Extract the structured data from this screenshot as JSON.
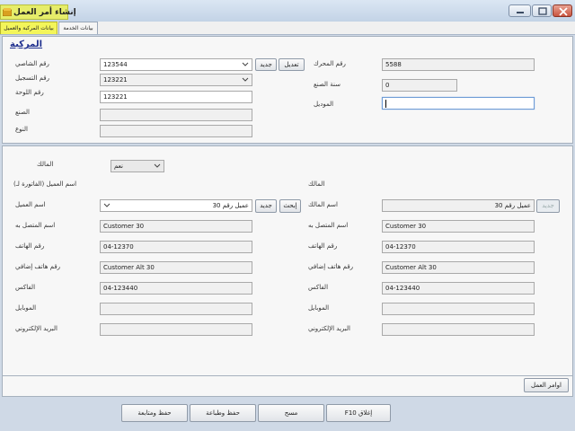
{
  "window": {
    "title": "إنشاء أمر العمل"
  },
  "tabs": [
    {
      "label": "بيانات المركبة والعميل"
    },
    {
      "label": "بيانات الخدمة"
    }
  ],
  "vehicle": {
    "section_title": "المركبة",
    "chassis_label": "رقم الشاصي",
    "chassis_value": "123544",
    "new_label": "جديد",
    "edit_label": "تعديل",
    "registration_label": "رقم التسجيل",
    "registration_value": "123221",
    "plate_label": "رقم اللوحة",
    "plate_value": "123221",
    "make_label": "الصنع",
    "make_value": "",
    "type_label": "النوع",
    "type_value": "",
    "engine_label": "رقم المحرك",
    "engine_value": "5588",
    "year_label": "سنة الصنع",
    "year_value": "0",
    "model_label": "الموديل",
    "model_value": ""
  },
  "customer": {
    "owner_label": "المالك",
    "owner_select": "نعم",
    "invoice_name_label": "اسم العميل (الفاتورة لـ)",
    "customer_name_label": "اسم العميل",
    "customer_name_value": "عميل رقم 30",
    "new_label": "جديد",
    "search_label": "إبحث",
    "contact_label": "اسم المتصل به",
    "contact_value": "Customer 30",
    "phone_label": "رقم الهاتف",
    "phone_value": "04-12370",
    "alt_phone_label": "رقم هاتف إضافي",
    "alt_phone_value": "Customer Alt 30",
    "fax_label": "الفاكس",
    "fax_value": "04-123440",
    "mobile_label": "الموبايل",
    "mobile_value": "",
    "email_label": "البريد الإلكتروني",
    "email_value": "",
    "owner_section_label": "المالك",
    "owner_name_label": "اسم المالك",
    "owner_name_value": "عميل رقم 30",
    "owner_small_btn": "جديد",
    "owner_contact_label": "اسم المتصل به",
    "owner_contact_value": "Customer 30",
    "owner_phone_label": "رقم الهاتف",
    "owner_phone_value": "04-12370",
    "owner_alt_phone_label": "رقم هاتف إضافي",
    "owner_alt_phone_value": "Customer Alt 30",
    "owner_fax_label": "الفاكس",
    "owner_fax_value": "04-123440",
    "owner_mobile_label": "الموبايل",
    "owner_mobile_value": "",
    "owner_email_label": "البريد الإلكتروني",
    "owner_email_value": ""
  },
  "work_orders_label": "اوامر العمل",
  "footer": {
    "save_follow": "حفظ ومتابعة",
    "save_print": "حفظ وطباعة",
    "clear": "مسح",
    "close": "F10 إغلاق"
  },
  "colors": {
    "accent_tab": "#f3f55a",
    "title_highlight": "#e6ed6a",
    "section_title": "#1e2f8e"
  }
}
